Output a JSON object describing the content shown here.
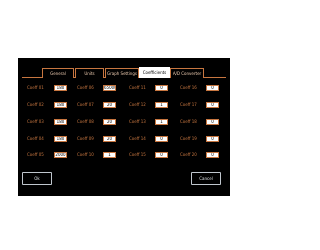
{
  "tabs": [
    {
      "label": "General"
    },
    {
      "label": "Units"
    },
    {
      "label": "Graph Settings"
    },
    {
      "label": "Coefficients"
    },
    {
      "label": "A/D Converter"
    }
  ],
  "coefficients": [
    {
      "label": "Coeff 01",
      "value": "180"
    },
    {
      "label": "Coeff 02",
      "value": "180"
    },
    {
      "label": "Coeff 03",
      "value": "180"
    },
    {
      "label": "Coeff 04",
      "value": "180"
    },
    {
      "label": "Coeff 05",
      "value": "2000"
    },
    {
      "label": "Coeff 06",
      "value": "65000"
    },
    {
      "label": "Coeff 07",
      "value": "20"
    },
    {
      "label": "Coeff 08",
      "value": "20"
    },
    {
      "label": "Coeff 09",
      "value": "20"
    },
    {
      "label": "Coeff 10",
      "value": "1"
    },
    {
      "label": "Coeff 11",
      "value": "0"
    },
    {
      "label": "Coeff 12",
      "value": "1"
    },
    {
      "label": "Coeff 13",
      "value": "1"
    },
    {
      "label": "Coeff 14",
      "value": "0"
    },
    {
      "label": "Coeff 15",
      "value": "0"
    },
    {
      "label": "Coeff 16",
      "value": "0"
    },
    {
      "label": "Coeff 17",
      "value": "0"
    },
    {
      "label": "Coeff 18",
      "value": "0"
    },
    {
      "label": "Coeff 19",
      "value": "0"
    },
    {
      "label": "Coeff 20",
      "value": "0"
    }
  ],
  "buttons": {
    "ok": "Ok",
    "cancel": "Cancel"
  },
  "colors": {
    "accent": "#c77640",
    "background": "#000000",
    "field": "#ffffff"
  }
}
